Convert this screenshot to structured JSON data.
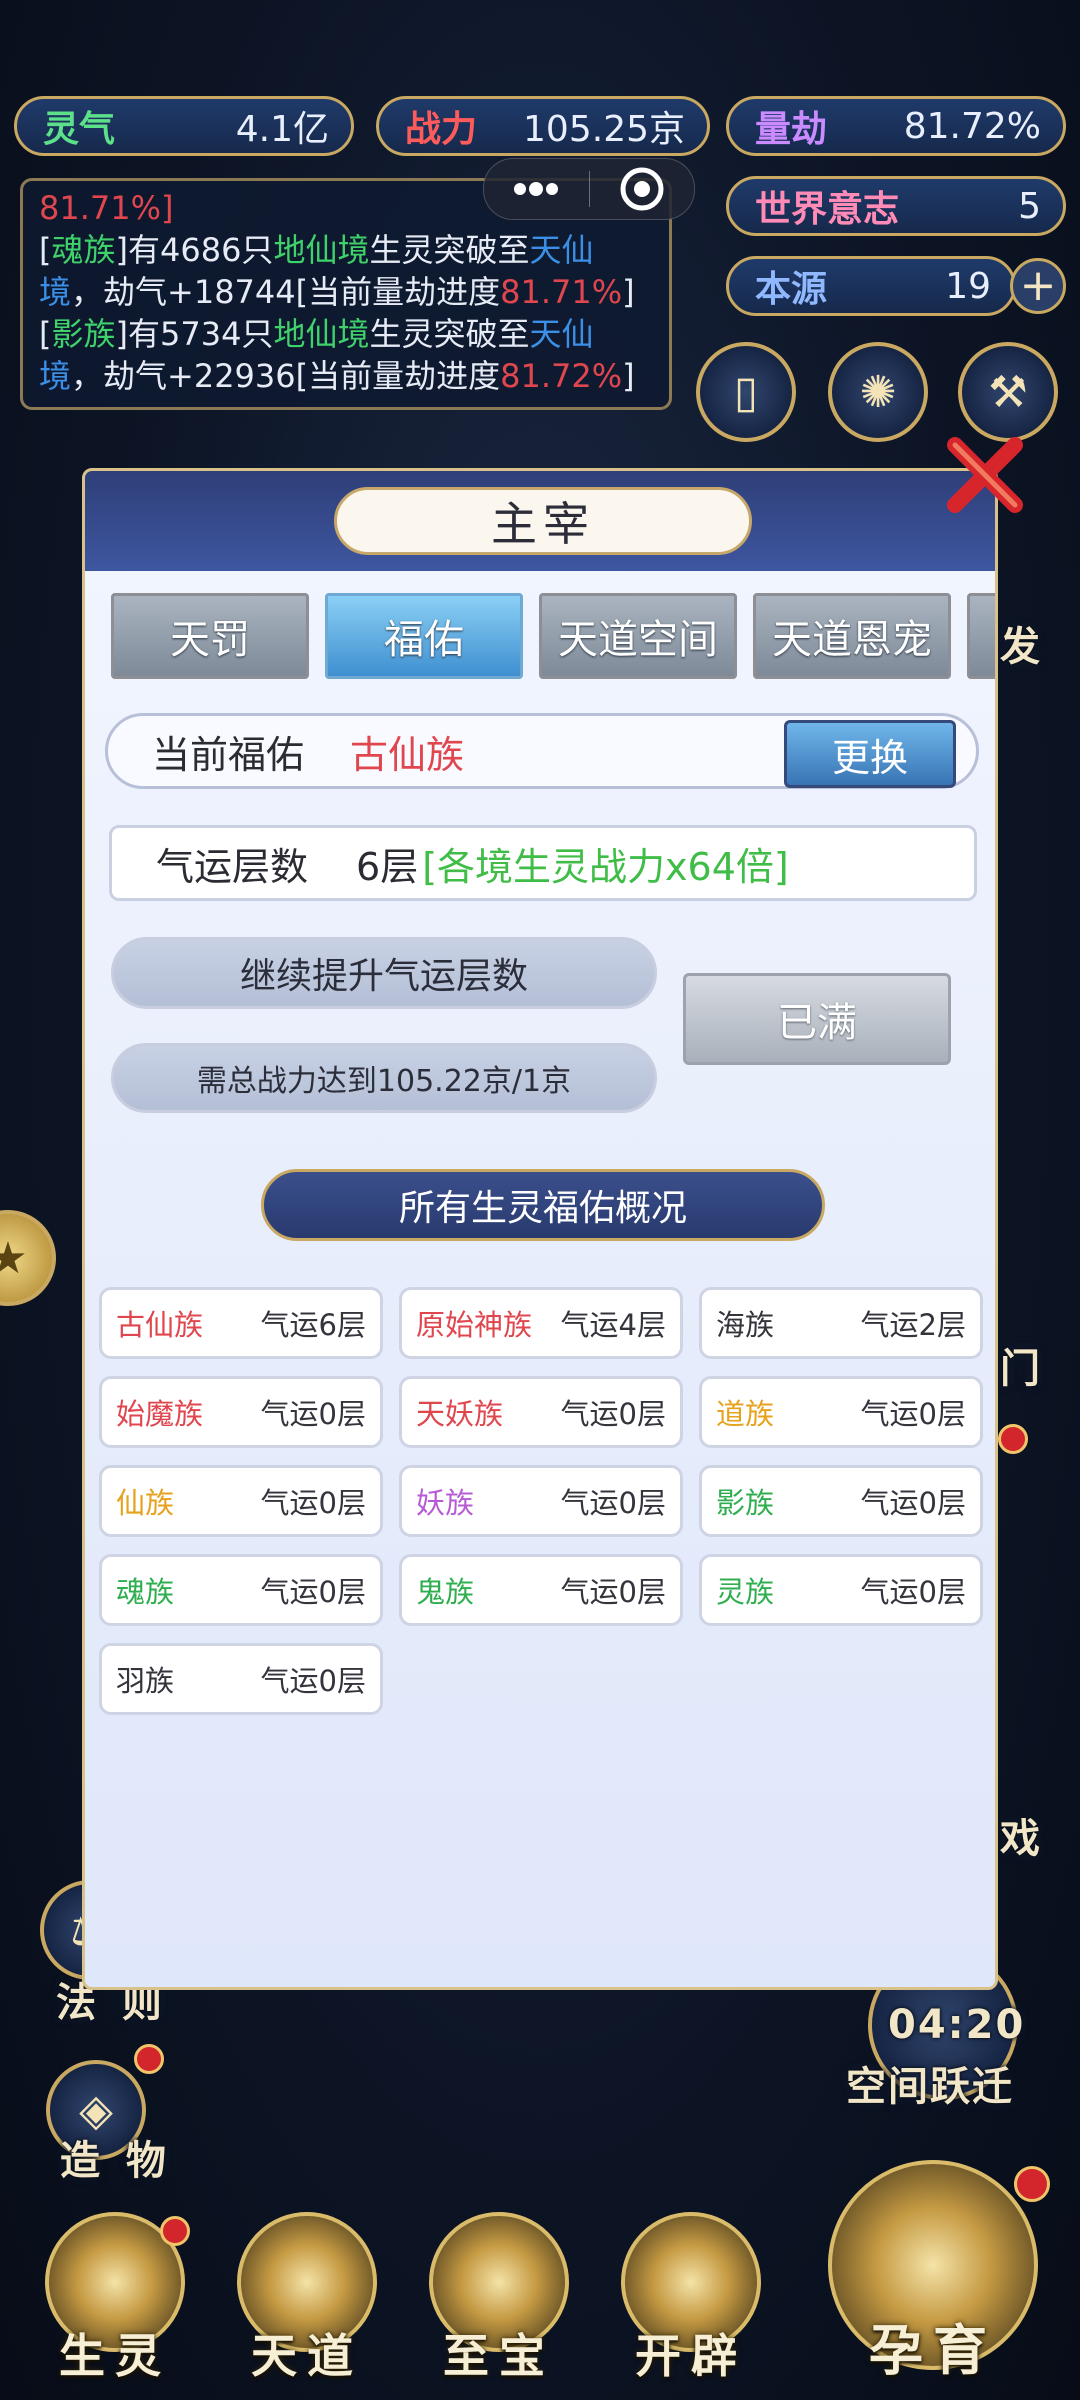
{
  "resources": {
    "lingqi": {
      "label": "灵气",
      "value": "4.1亿"
    },
    "zhanli": {
      "label": "战力",
      "value": "105.25京"
    },
    "liangjie": {
      "label": "量劫",
      "value": "81.72%"
    },
    "shijie": {
      "label": "世界意志",
      "value": "5"
    },
    "benyuan": {
      "label": "本源",
      "value": "19"
    }
  },
  "log": {
    "line0": "81.71%]",
    "e1": {
      "race": "魂族",
      "a": "有4686只",
      "realm": "地仙境",
      "b": "生灵突破至",
      "target": "天仙境",
      "c": "，劫气+18744[当前量劫进度",
      "pct": "81.71%",
      "d": "]"
    },
    "e2": {
      "race": "影族",
      "a": "有5734只",
      "realm": "地仙境",
      "b": "生灵突破至",
      "target": "天仙境",
      "c": "，劫气+22936[当前量劫进度",
      "pct": "81.72%",
      "d": "]"
    }
  },
  "side": {
    "left_labels": [
      "法 则",
      "造 物"
    ],
    "right_label_timer": "04:20",
    "right_label_jump": "空间跃迁",
    "peek": [
      "发",
      "门",
      "戏"
    ]
  },
  "panel": {
    "title": "主宰",
    "tabs": [
      "天罚",
      "福佑",
      "天道空间",
      "天道恩宠"
    ],
    "current_label": "当前福佑",
    "current_value": "古仙族",
    "swap_label": "更换",
    "fortune_label": "气运层数",
    "fortune_value": "6层",
    "fortune_bonus": "[各境生灵战力x64倍]",
    "upgrade_label": "继续提升气运层数",
    "requirement": "需总战力达到105.22京/1京",
    "full_label": "已满",
    "section_title": "所有生灵福佑概况",
    "races": [
      {
        "name": "古仙族",
        "level": "气运6层",
        "color": "#e0464e"
      },
      {
        "name": "原始神族",
        "level": "气运4层",
        "color": "#e0464e"
      },
      {
        "name": "海族",
        "level": "气运2层",
        "color": "#33343c"
      },
      {
        "name": "始魔族",
        "level": "气运0层",
        "color": "#e0464e"
      },
      {
        "name": "天妖族",
        "level": "气运0层",
        "color": "#e0464e"
      },
      {
        "name": "道族",
        "level": "气运0层",
        "color": "#e7a21c"
      },
      {
        "name": "仙族",
        "level": "气运0层",
        "color": "#e7a21c"
      },
      {
        "name": "妖族",
        "level": "气运0层",
        "color": "#b75ad6"
      },
      {
        "name": "影族",
        "level": "气运0层",
        "color": "#2fae4f"
      },
      {
        "name": "魂族",
        "level": "气运0层",
        "color": "#2fae4f"
      },
      {
        "name": "鬼族",
        "level": "气运0层",
        "color": "#2fae4f"
      },
      {
        "name": "灵族",
        "level": "气运0层",
        "color": "#2fae4f"
      },
      {
        "name": "羽族",
        "level": "气运0层",
        "color": "#33343c"
      }
    ]
  },
  "nav": [
    "生灵",
    "天道",
    "至宝",
    "开辟",
    "孕育"
  ]
}
